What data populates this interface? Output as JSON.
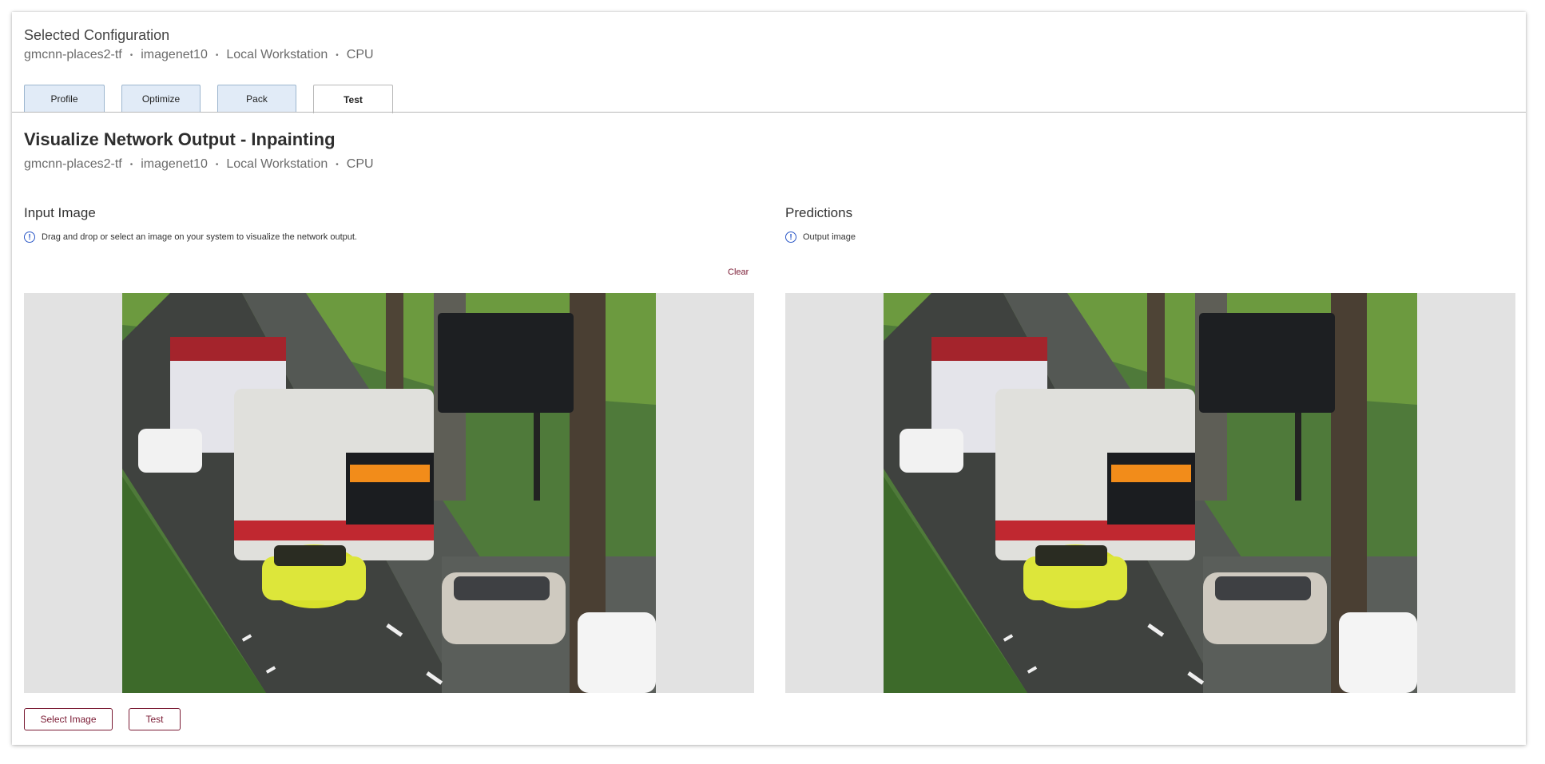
{
  "config": {
    "title": "Selected Configuration",
    "model": "gmcnn-places2-tf",
    "dataset": "imagenet10",
    "target": "Local Workstation",
    "device": "CPU"
  },
  "tabs": [
    {
      "label": "Profile"
    },
    {
      "label": "Optimize"
    },
    {
      "label": "Pack"
    },
    {
      "label": "Test"
    }
  ],
  "page": {
    "title": "Visualize Network Output - Inpainting",
    "model": "gmcnn-places2-tf",
    "dataset": "imagenet10",
    "target": "Local Workstation",
    "device": "CPU"
  },
  "input": {
    "title": "Input Image",
    "hint": "Drag and drop or select an image on your system to visualize the network output.",
    "clear_label": "Clear"
  },
  "predictions": {
    "title": "Predictions",
    "hint": "Output image"
  },
  "buttons": {
    "select_image": "Select Image",
    "test": "Test"
  },
  "colors": {
    "accent": "#7a1a33",
    "info": "#2b58c7",
    "tab_bg": "#e1ebf7",
    "panel_bg": "#e2e2e2"
  }
}
